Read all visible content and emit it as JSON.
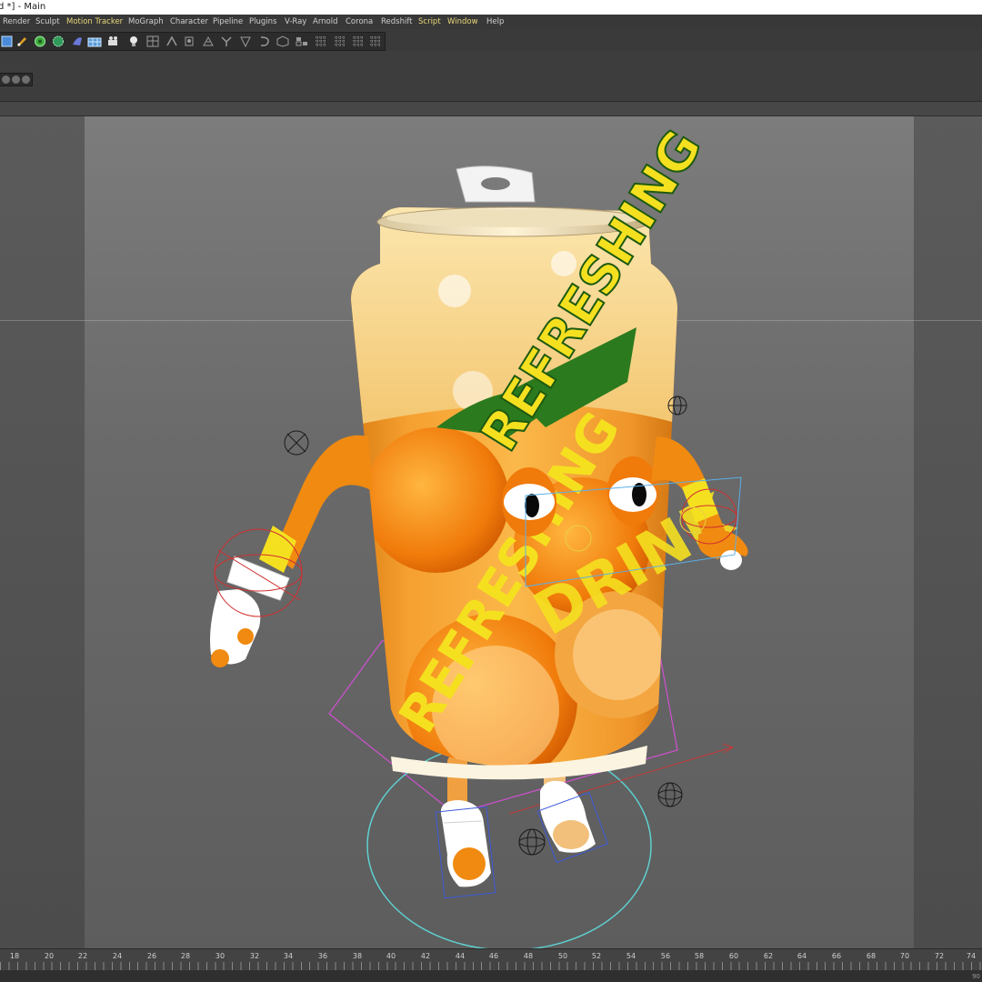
{
  "window": {
    "title": "d *] - Main"
  },
  "menu": [
    {
      "label": "Render",
      "highlight": false
    },
    {
      "label": "Sculpt",
      "highlight": false
    },
    {
      "label": "Motion Tracker",
      "highlight": true
    },
    {
      "label": "MoGraph",
      "highlight": false
    },
    {
      "label": "Character",
      "highlight": false
    },
    {
      "label": "Pipeline",
      "highlight": false
    },
    {
      "label": "Plugins",
      "highlight": false
    },
    {
      "label": "V-Ray",
      "highlight": false
    },
    {
      "label": "Arnold",
      "highlight": false
    },
    {
      "label": "Corona",
      "highlight": false
    },
    {
      "label": "Redshift",
      "highlight": false
    },
    {
      "label": "Script",
      "highlight": true
    },
    {
      "label": "Window",
      "highlight": true
    },
    {
      "label": "Help",
      "highlight": false
    }
  ],
  "toolbar": {
    "icons": [
      "cube-icon",
      "pen-icon",
      "subdivision-icon",
      "array-icon",
      "deformer-icon",
      "floor-icon",
      "camera-icon",
      "light-icon",
      "joint-icon",
      "ik-icon",
      "character-icon",
      "weight-icon",
      "cmotion-icon",
      "pose-icon",
      "constraint-icon",
      "morph-icon",
      "cluster-icon",
      "mesh-icon",
      "grid-icon"
    ]
  },
  "scene": {
    "can_text_1": "REFRESHING",
    "can_text_2": "DRINK"
  },
  "timeline": {
    "labels": [
      "18",
      "20",
      "22",
      "24",
      "26",
      "28",
      "30",
      "32",
      "34",
      "36",
      "38",
      "40",
      "42",
      "44",
      "46",
      "48",
      "50",
      "52",
      "54",
      "56",
      "58",
      "60",
      "62",
      "64",
      "66",
      "68",
      "70",
      "72",
      "74"
    ],
    "edge_label": "90"
  },
  "colors": {
    "menu_highlight": "#e8d77a",
    "viewport_bg": "#6a6a6a",
    "rig_cyan": "#5fd0d0",
    "rig_magenta": "#d050d0",
    "rig_red": "#d03030",
    "can_orange": "#f08a10",
    "can_yellow": "#f5e020"
  }
}
